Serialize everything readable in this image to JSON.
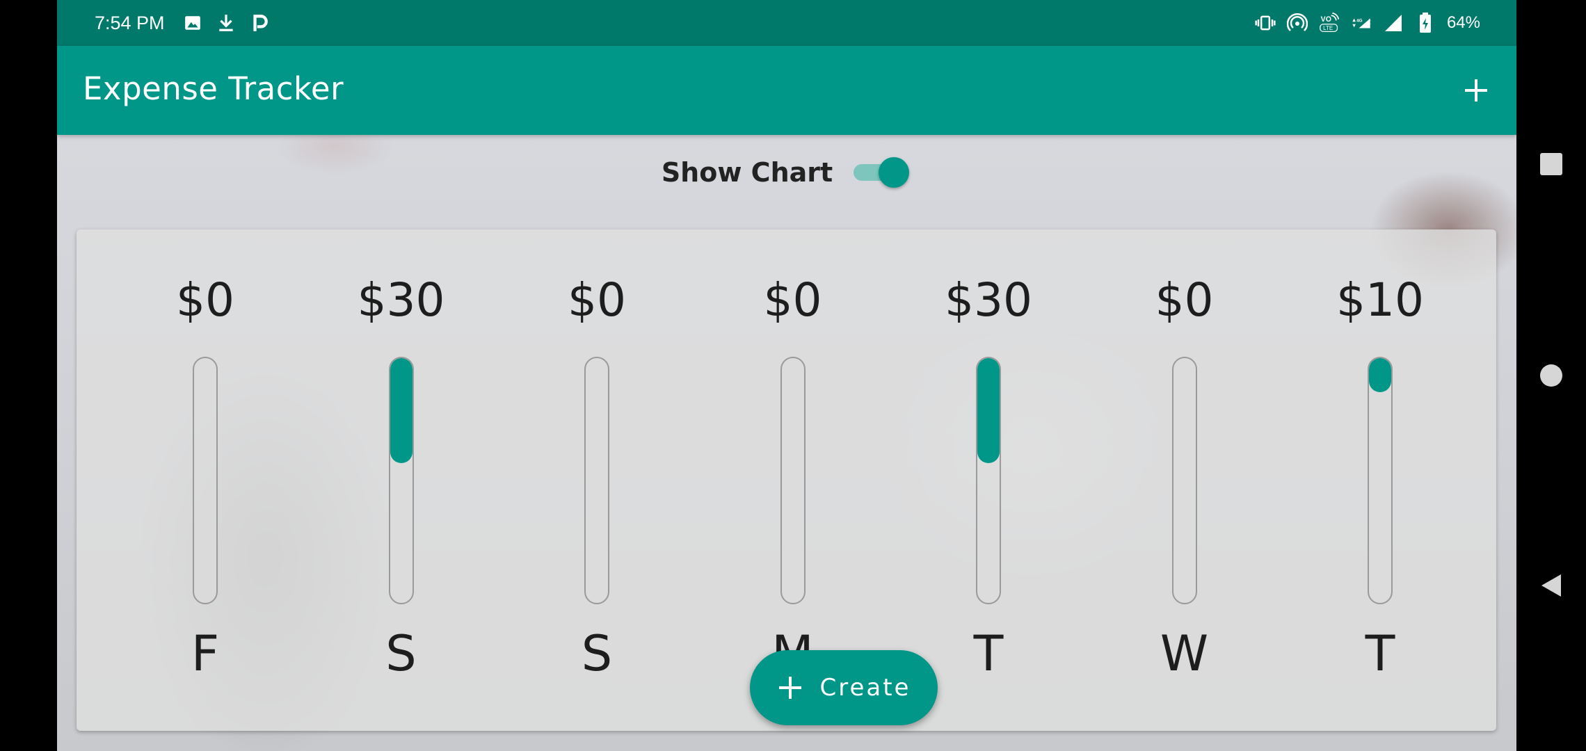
{
  "status_bar": {
    "time": "7:54 PM",
    "battery": "64%",
    "left_icons": [
      "image-icon",
      "download-icon",
      "p-app-icon"
    ],
    "right_icons": [
      "vibrate-icon",
      "hotspot-icon",
      "volte-icon",
      "network-4g-icon",
      "signal-icon",
      "signal-2-icon",
      "battery-icon"
    ]
  },
  "app_bar": {
    "title": "Expense Tracker",
    "add_icon": "plus-icon"
  },
  "toggle": {
    "label": "Show Chart",
    "on": true
  },
  "chart": {
    "bars": [
      {
        "day": "F",
        "amount": "$0",
        "fraction": 0.0
      },
      {
        "day": "S",
        "amount": "$30",
        "fraction": 0.43
      },
      {
        "day": "S",
        "amount": "$0",
        "fraction": 0.0
      },
      {
        "day": "M",
        "amount": "$0",
        "fraction": 0.0
      },
      {
        "day": "T",
        "amount": "$30",
        "fraction": 0.43
      },
      {
        "day": "W",
        "amount": "$0",
        "fraction": 0.0
      },
      {
        "day": "T",
        "amount": "$10",
        "fraction": 0.14
      }
    ]
  },
  "fab": {
    "label": "Create",
    "icon": "plus-icon"
  },
  "nav": {
    "buttons": [
      "recents-icon",
      "home-icon",
      "back-icon"
    ]
  },
  "colors": {
    "primary": "#009688",
    "primary_dark": "#00796b",
    "switch_track": "#7ec5bd"
  }
}
